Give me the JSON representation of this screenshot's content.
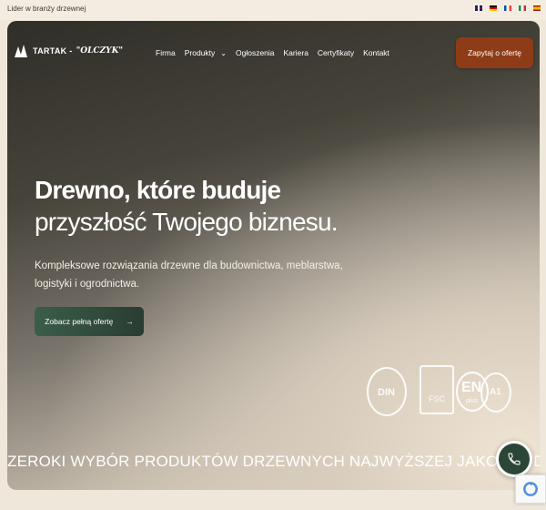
{
  "topbar": {
    "tagline": "Lider w branży drzewnej",
    "flags": [
      "uk",
      "de",
      "fr",
      "it",
      "es"
    ]
  },
  "header": {
    "logo_text": "TARTAK -",
    "logo_script": "\"OLCZYK\"",
    "nav": [
      "Firma",
      "Produkty",
      "Ogłoszenia",
      "Kariera",
      "Certyfikaty",
      "Kontakt"
    ],
    "cta": "Zapytaj o ofertę"
  },
  "hero": {
    "title_bold": "Drewno, które buduje",
    "title_light": "przyszłość Twojego biznesu.",
    "subtitle": "Kompleksowe rozwiązania drzewne dla budownictwa, meblarstwa, logistyki i ogrodnictwa.",
    "offer_button": "Zobacz pełną ofertę"
  },
  "certificates": {
    "din": "DIN",
    "fsc": "FSC",
    "en": "EN",
    "en_sub": "plus",
    "a1": "A1"
  },
  "marquee": "ZEROKI WYBÓR PRODUKTÓW DRZEWNYCH NAJWYŻSZEJ JAKOŚCI, DOSTOSOW",
  "colors": {
    "cta": "#8e3c17",
    "offer": "#3a5e49",
    "phone": "#2b4636"
  }
}
